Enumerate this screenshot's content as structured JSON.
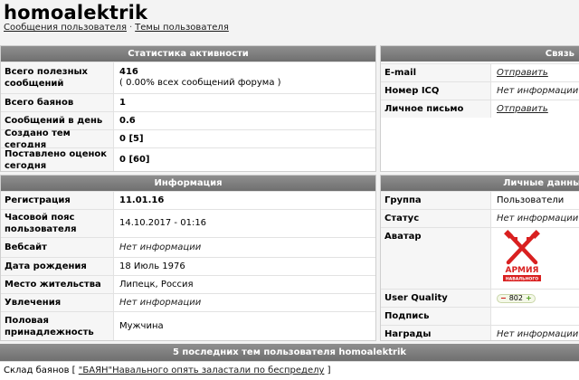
{
  "header": {
    "username": "homoalektrik",
    "link_messages": "Сообщения пользователя",
    "link_separator": "·",
    "link_topics": "Темы пользователя"
  },
  "stats": {
    "title": "Статистика активности",
    "rows": [
      {
        "label": "Всего полезных сообщений",
        "value": "416",
        "sub": "( 0.00% всех сообщений форума )"
      },
      {
        "label": "Всего баянов",
        "value": "1"
      },
      {
        "label": "Сообщений в день",
        "value": "0.6"
      },
      {
        "label": "Создано тем сегодня",
        "value": "0 [5]"
      },
      {
        "label": "Поставлено оценок сегодня",
        "value": "0 [60]"
      }
    ]
  },
  "contacts": {
    "title": "Связь",
    "rows": [
      {
        "label": "E-mail",
        "value": "Отправить"
      },
      {
        "label": "Номер ICQ",
        "value": "Нет информации"
      },
      {
        "label": "Личное письмо",
        "value": "Отправить"
      }
    ]
  },
  "info": {
    "title": "Информация",
    "rows": [
      {
        "label": "Регистрация",
        "value": "11.01.16"
      },
      {
        "label": "Часовой пояс пользователя",
        "value": "14.10.2017 - 01:16"
      },
      {
        "label": "Вебсайт",
        "value": "Нет информации"
      },
      {
        "label": "Дата рождения",
        "value": "18 Июль 1976"
      },
      {
        "label": "Место жительства",
        "value": "Липецк, Россия"
      },
      {
        "label": "Увлечения",
        "value": "Нет информации"
      },
      {
        "label": "Половая принадлежность",
        "value": "Мужчина"
      }
    ]
  },
  "personal": {
    "title": "Личные данные",
    "rows": [
      {
        "label": "Группа",
        "value": "Пользователи"
      },
      {
        "label": "Статус",
        "value": "Нет информации"
      },
      {
        "label": "Аватар",
        "avatar_text_1": "АРМИЯ",
        "avatar_text_2": "НАВАЛЬНОГО"
      },
      {
        "label": "User Quality",
        "minus": "−",
        "value": "802",
        "plus": "+"
      },
      {
        "label": "Подпись",
        "value": ""
      },
      {
        "label": "Награды",
        "value": "Нет информации"
      }
    ]
  },
  "footer": {
    "title": "5 последних тем пользователя homoalektrik",
    "topic_prefix": "Склад баянов [",
    "topic_link": "\"БАЯН\"Навального опять заластали по беспределу",
    "topic_suffix": "]"
  },
  "colors": {
    "header_bar": "#7f7f7f",
    "avatar_red": "#d92020"
  }
}
